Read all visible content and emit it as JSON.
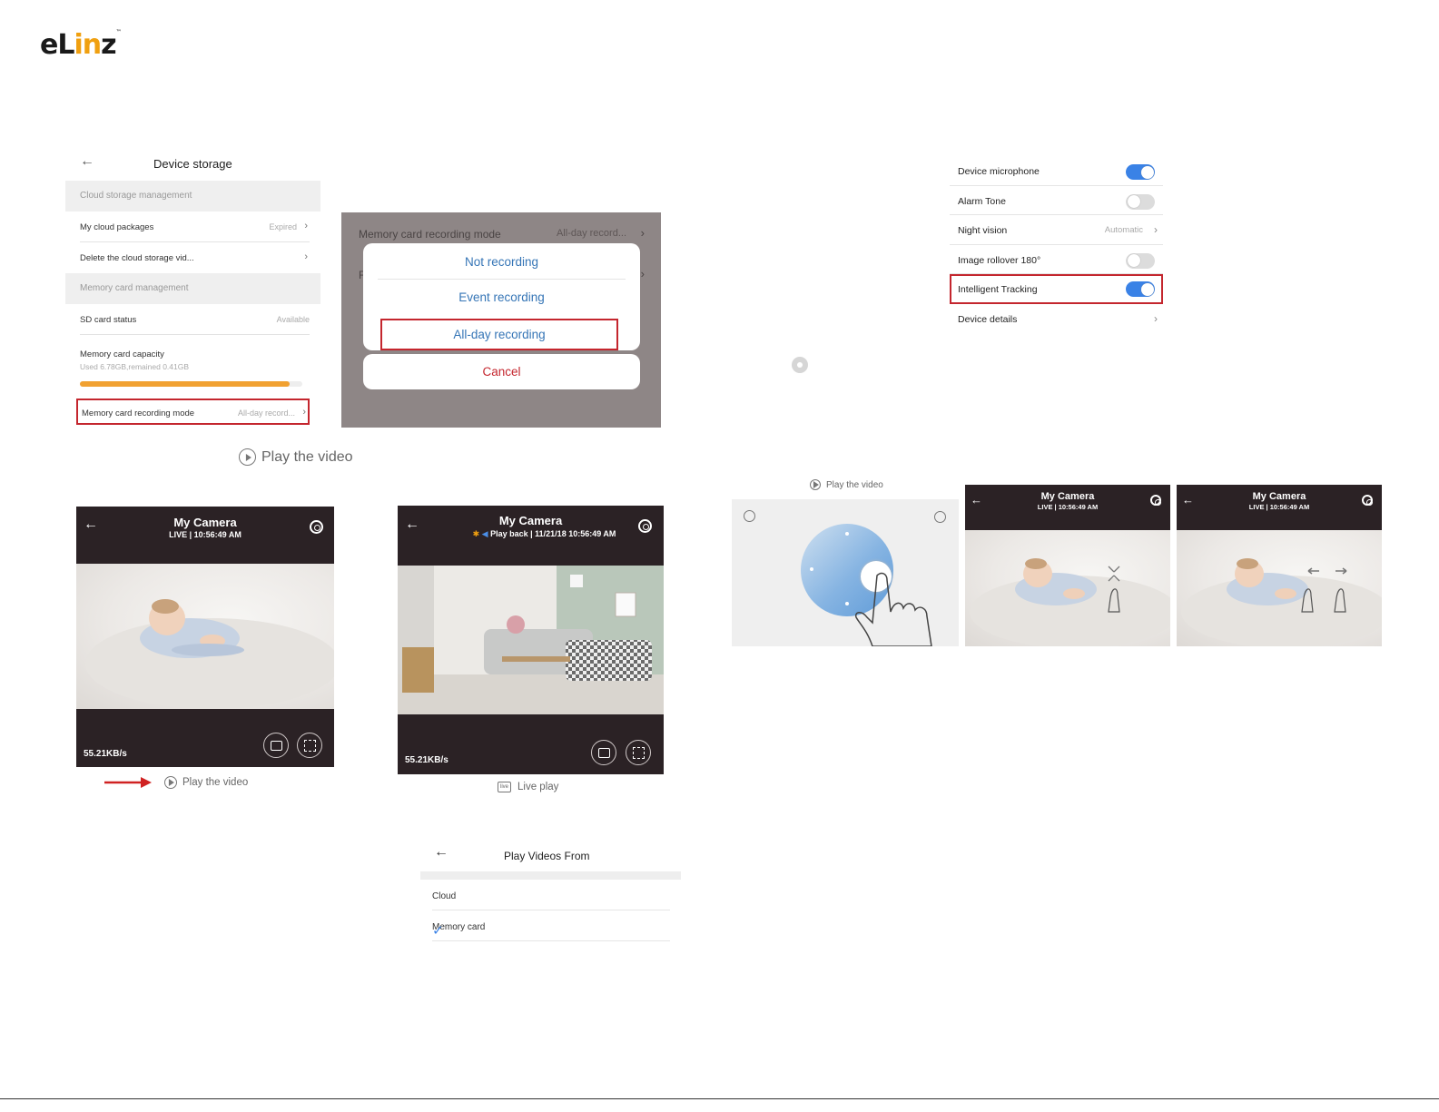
{
  "logo": {
    "part1": "eL",
    "part2": "in",
    "part3": "z",
    "tm": "™"
  },
  "device_storage": {
    "title": "Device storage",
    "section_cloud": "Cloud storage management",
    "cloud_packages_label": "My cloud packages",
    "cloud_packages_value": "Expired",
    "delete_cloud_label": "Delete the cloud storage vid...",
    "section_memory": "Memory card management",
    "sd_status_label": "SD card status",
    "sd_status_value": "Available",
    "capacity_label": "Memory card capacity",
    "capacity_sub": "Used 6.78GB,remained 0.41GB",
    "capacity_fraction": 0.943,
    "recording_mode_label": "Memory card recording mode",
    "recording_mode_value": "All-day record..."
  },
  "recording_dialog": {
    "bg_label": "Memory card recording mode",
    "bg_value": "All-day record...",
    "bg_second_row": "F",
    "options": [
      "Not recording",
      "Event recording",
      "All-day recording"
    ],
    "cancel": "Cancel"
  },
  "caption_play_large": "Play the video",
  "caption_play_small": "Play the video",
  "caption_play_tiny": "Play the video",
  "caption_live_play": "Live play",
  "caption_live_icon": "live",
  "camera_live": {
    "title": "My Camera",
    "subtitle": "LIVE  |  10:56:49 AM",
    "speed": "55.21KB/s"
  },
  "camera_playback": {
    "title": "My Camera",
    "subtitle": "Play back  |  11/21/18 10:56:49 AM",
    "speed": "55.21KB/s"
  },
  "camera_small_1": {
    "title": "My Camera",
    "subtitle": "LIVE  |  10:56:49 AM"
  },
  "camera_small_2": {
    "title": "My Camera",
    "subtitle": "LIVE  |  10:56:49 AM"
  },
  "settings": {
    "microphone": "Device microphone",
    "alarm": "Alarm Tone",
    "night_vision": "Night vision",
    "night_vision_value": "Automatic",
    "rollover": "Image rollover 180°",
    "tracking": "Intelligent Tracking",
    "details": "Device details"
  },
  "play_videos_from": {
    "title": "Play Videos From",
    "cloud": "Cloud",
    "memory_card": "Memory card"
  },
  "colors": {
    "highlight": "#c4262e",
    "toggle_on": "#3a82e6",
    "progress": "#f1a131",
    "dialog_text": "#3575b6",
    "camera_bg": "#2b2225"
  }
}
